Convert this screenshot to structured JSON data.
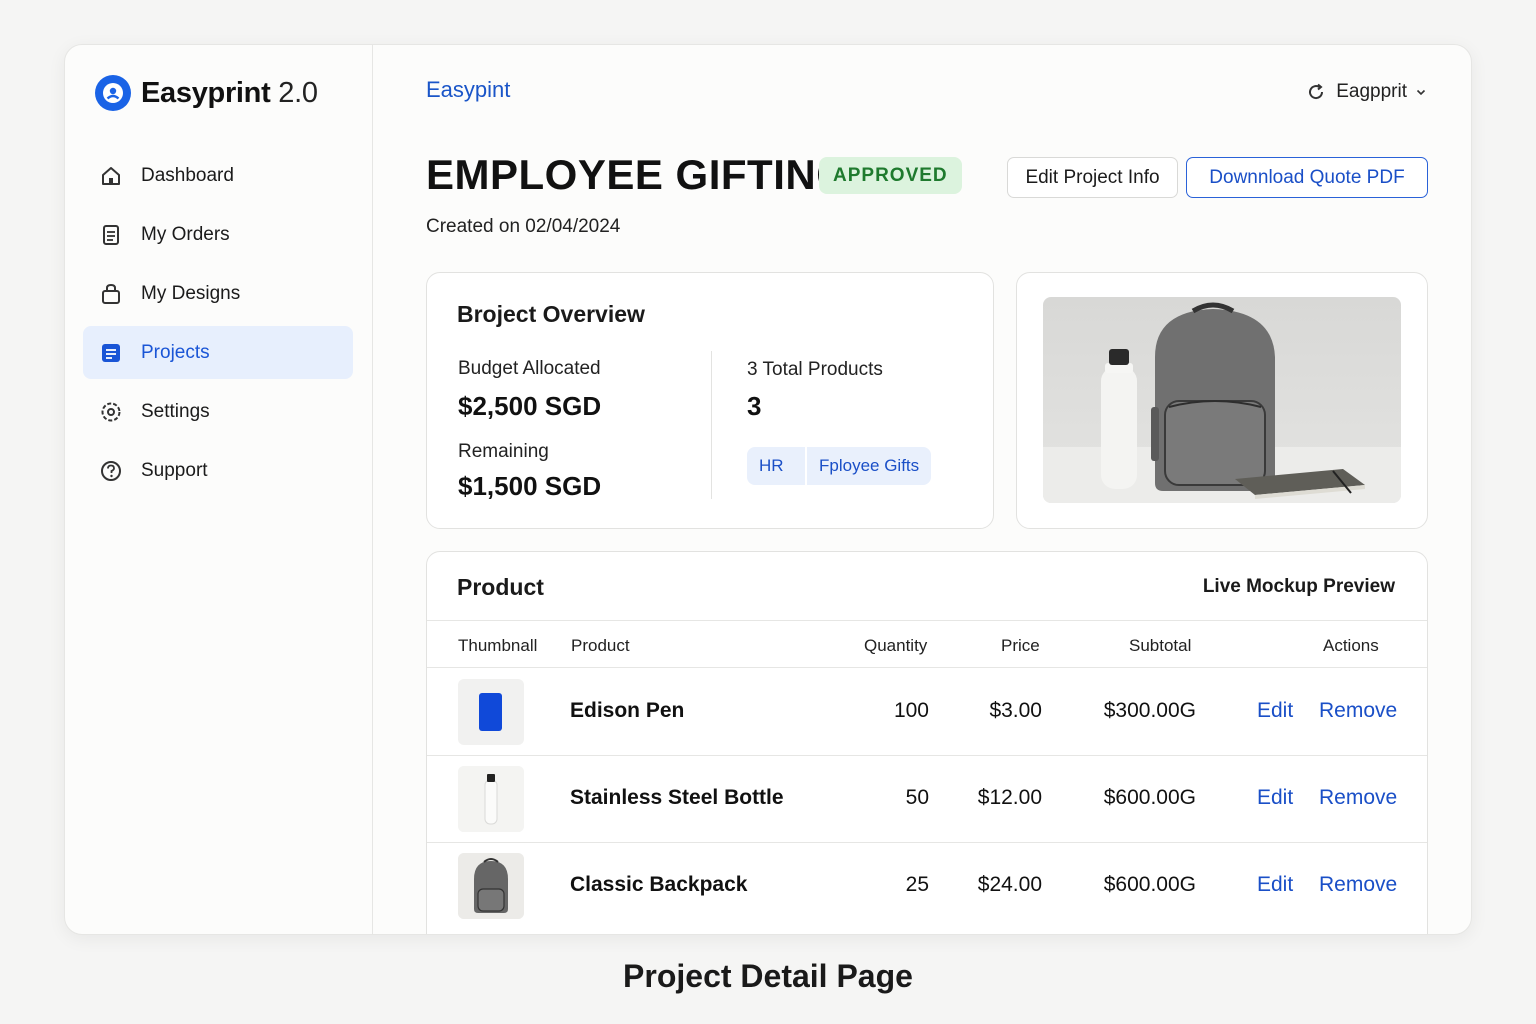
{
  "app": {
    "name": "Easyprint",
    "version": "2.0"
  },
  "sidebar": {
    "items": [
      {
        "label": "Dashboard",
        "icon": "home-icon",
        "active": false
      },
      {
        "label": "My Orders",
        "icon": "document-icon",
        "active": false
      },
      {
        "label": "My Designs",
        "icon": "bag-icon",
        "active": false
      },
      {
        "label": "Projects",
        "icon": "projects-icon",
        "active": true
      },
      {
        "label": "Settings",
        "icon": "gear-icon",
        "active": false
      },
      {
        "label": "Support",
        "icon": "help-circle-icon",
        "active": false
      }
    ]
  },
  "header": {
    "brand": "Easypint",
    "user_menu_label": "Eagpprit",
    "user_menu_icon": "refresh-icon",
    "chevron_icon": "chevron-down-icon"
  },
  "project": {
    "title": "EMPLOYEE GIFTING",
    "status": "APPROVED",
    "created": "Created on 02/04/2024",
    "edit_button": "Edit Project Info",
    "download_button": "Downnload Quote PDF"
  },
  "overview": {
    "title": "Broject Overview",
    "budget_label": "Budget Allocated",
    "budget_value": "$2,500 SGD",
    "remaining_label": "Remaining",
    "remaining_value": "$1,500 SGD",
    "total_label": "3 Total  Products",
    "total_value": "3",
    "tags": [
      "HR",
      "Fployee Gifts"
    ]
  },
  "products": {
    "title": "Product",
    "live_preview": "Live Mockup Preview",
    "columns": [
      "Thumbnall",
      "Product",
      "Quantity",
      "Price",
      "Subtotal",
      "Actions"
    ],
    "rows": [
      {
        "name": "Edison Pen",
        "qty": "100",
        "price": "$3.00",
        "subtotal": "$300.00G",
        "edit": "Edit",
        "remove": "Remove",
        "thumb": "pen"
      },
      {
        "name": "Stainless Steel Bottle",
        "qty": "50",
        "price": "$12.00",
        "subtotal": "$600.00G",
        "edit": "Edit",
        "remove": "Remove",
        "thumb": "bottle"
      },
      {
        "name": "Classic Backpack",
        "qty": "25",
        "price": "$24.00",
        "subtotal": "$600.00G",
        "edit": "Edit",
        "remove": "Remove",
        "thumb": "backpack"
      }
    ]
  },
  "caption": "Project Detail Page",
  "colors": {
    "accent": "#1a55d6",
    "approved_bg": "#dcf3de",
    "approved_text": "#1f7a2e"
  }
}
